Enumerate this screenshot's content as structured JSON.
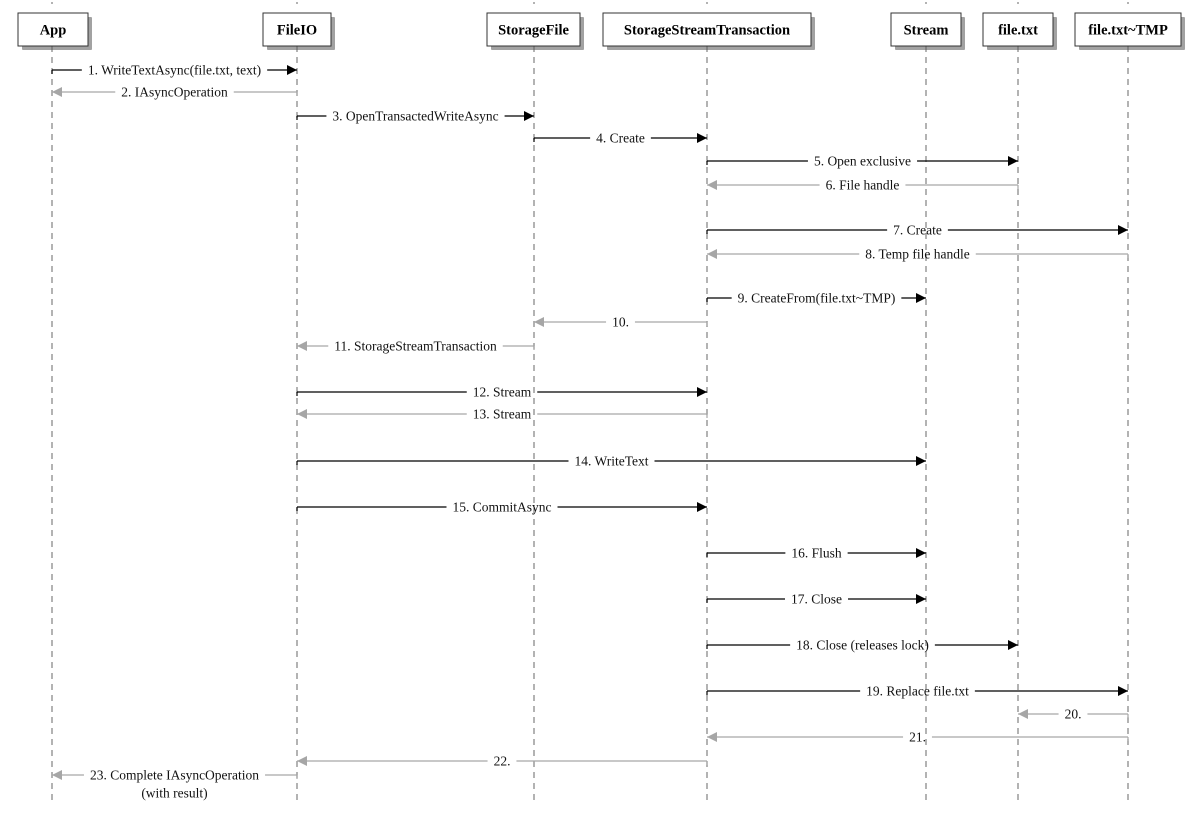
{
  "diagram": {
    "type": "sequence",
    "colors": {
      "call": "#000000",
      "return": "#a6a6a6",
      "lifeline": "#8a8a8a"
    },
    "participants": [
      {
        "id": "app",
        "label": "App"
      },
      {
        "id": "fileio",
        "label": "FileIO"
      },
      {
        "id": "storagefile",
        "label": "StorageFile"
      },
      {
        "id": "sst",
        "label": "StorageStreamTransaction"
      },
      {
        "id": "stream",
        "label": "Stream"
      },
      {
        "id": "filetxt",
        "label": "file.txt"
      },
      {
        "id": "filetmp",
        "label": "file.txt~TMP"
      }
    ],
    "messages": [
      {
        "n": 1,
        "from": "app",
        "to": "fileio",
        "kind": "call",
        "label": "1. WriteTextAsync(file.txt, text)"
      },
      {
        "n": 2,
        "from": "fileio",
        "to": "app",
        "kind": "return",
        "label": "2. IAsyncOperation"
      },
      {
        "n": 3,
        "from": "fileio",
        "to": "storagefile",
        "kind": "call",
        "label": "3. OpenTransactedWriteAsync"
      },
      {
        "n": 4,
        "from": "storagefile",
        "to": "sst",
        "kind": "call",
        "label": "4. Create"
      },
      {
        "n": 5,
        "from": "sst",
        "to": "filetxt",
        "kind": "call",
        "label": "5. Open exclusive"
      },
      {
        "n": 6,
        "from": "filetxt",
        "to": "sst",
        "kind": "return",
        "label": "6. File handle"
      },
      {
        "n": 7,
        "from": "sst",
        "to": "filetmp",
        "kind": "call",
        "label": "7. Create"
      },
      {
        "n": 8,
        "from": "filetmp",
        "to": "sst",
        "kind": "return",
        "label": "8. Temp file handle"
      },
      {
        "n": 9,
        "from": "sst",
        "to": "stream",
        "kind": "call",
        "label": "9. CreateFrom(file.txt~TMP)"
      },
      {
        "n": 10,
        "from": "sst",
        "to": "storagefile",
        "kind": "return",
        "label": "10."
      },
      {
        "n": 11,
        "from": "storagefile",
        "to": "fileio",
        "kind": "return",
        "label": "11. StorageStreamTransaction"
      },
      {
        "n": 12,
        "from": "fileio",
        "to": "sst",
        "kind": "call",
        "label": "12. Stream"
      },
      {
        "n": 13,
        "from": "sst",
        "to": "fileio",
        "kind": "return",
        "label": "13. Stream"
      },
      {
        "n": 14,
        "from": "fileio",
        "to": "stream",
        "kind": "call",
        "label": "14. WriteText"
      },
      {
        "n": 15,
        "from": "fileio",
        "to": "sst",
        "kind": "call",
        "label": "15. CommitAsync"
      },
      {
        "n": 16,
        "from": "sst",
        "to": "stream",
        "kind": "call",
        "label": "16. Flush"
      },
      {
        "n": 17,
        "from": "sst",
        "to": "stream",
        "kind": "call",
        "label": "17. Close"
      },
      {
        "n": 18,
        "from": "sst",
        "to": "filetxt",
        "kind": "call",
        "label": "18. Close (releases lock)"
      },
      {
        "n": 19,
        "from": "sst",
        "to": "filetmp",
        "kind": "call",
        "label": "19. Replace file.txt"
      },
      {
        "n": 20,
        "from": "filetmp",
        "to": "filetxt",
        "kind": "return",
        "label": "20."
      },
      {
        "n": 21,
        "from": "filetmp",
        "to": "sst",
        "kind": "return",
        "label": "21."
      },
      {
        "n": 22,
        "from": "sst",
        "to": "fileio",
        "kind": "return",
        "label": "22."
      },
      {
        "n": 23,
        "from": "fileio",
        "to": "app",
        "kind": "return",
        "label": "23. Complete IAsyncOperation",
        "label_line2": "(with result)"
      }
    ]
  }
}
